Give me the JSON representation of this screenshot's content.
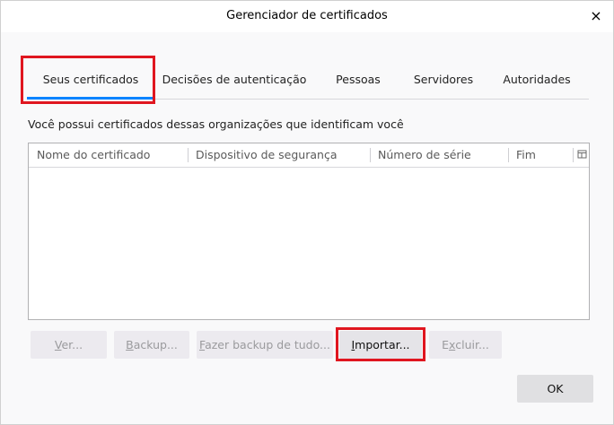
{
  "window": {
    "title": "Gerenciador de certificados",
    "close_label": "×"
  },
  "tabs": [
    {
      "label": "Seus certificados",
      "selected": true
    },
    {
      "label": "Decisões de autenticação",
      "selected": false
    },
    {
      "label": "Pessoas",
      "selected": false
    },
    {
      "label": "Servidores",
      "selected": false
    },
    {
      "label": "Autoridades",
      "selected": false
    }
  ],
  "description": "Você possui certificados dessas organizações que identificam você",
  "table": {
    "columns": [
      "Nome do certificado",
      "Dispositivo de segurança",
      "Número de série",
      "Fim"
    ],
    "rows": []
  },
  "buttons": {
    "view": {
      "access": "V",
      "rest": "er..."
    },
    "backup": {
      "access": "B",
      "rest": "ackup..."
    },
    "backup_all": {
      "access": "F",
      "rest": "azer backup de tudo..."
    },
    "import": {
      "access": "I",
      "rest": "mportar..."
    },
    "delete": {
      "access": "x",
      "pre": "E",
      "rest": "cluir..."
    },
    "ok": "OK"
  },
  "colors": {
    "accent": "#0a84ff",
    "highlight": "#e0161f"
  },
  "icons": {
    "close": "close-icon",
    "column_picker": "column-picker-icon"
  }
}
